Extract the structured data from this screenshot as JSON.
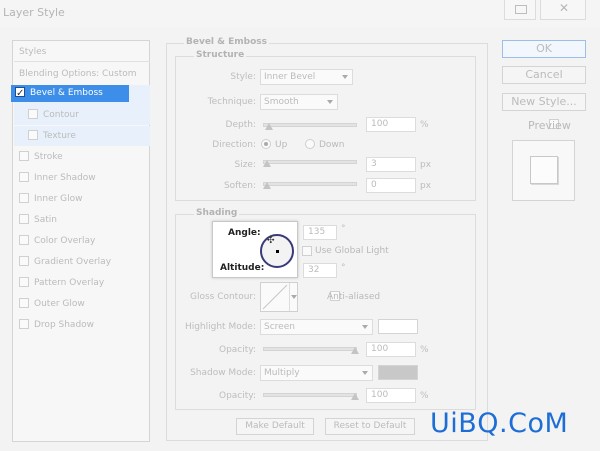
{
  "window": {
    "title": "Layer Style"
  },
  "styles_list": {
    "header": "Styles",
    "blending": "Blending Options: Custom",
    "bevel": "Bevel & Emboss",
    "contour": "Contour",
    "texture": "Texture",
    "items": [
      "Stroke",
      "Inner Shadow",
      "Inner Glow",
      "Satin",
      "Color Overlay",
      "Gradient Overlay",
      "Pattern Overlay",
      "Outer Glow",
      "Drop Shadow"
    ]
  },
  "bevel_emboss": {
    "group_title": "Bevel & Emboss",
    "structure_title": "Structure",
    "style_label": "Style:",
    "style_value": "Inner Bevel",
    "technique_label": "Technique:",
    "technique_value": "Smooth",
    "depth_label": "Depth:",
    "depth_value": "100",
    "depth_unit": "%",
    "direction_label": "Direction:",
    "direction_up": "Up",
    "direction_down": "Down",
    "size_label": "Size:",
    "size_value": "3",
    "size_unit": "px",
    "soften_label": "Soften:",
    "soften_value": "0",
    "soften_unit": "px"
  },
  "shading": {
    "group_title": "Shading",
    "angle_label": "Angle:",
    "angle_value": "135",
    "angle_unit": "°",
    "global_light_label": "Use Global Light",
    "altitude_label": "Altitude:",
    "altitude_value": "32",
    "altitude_unit": "°",
    "gloss_label": "Gloss Contour:",
    "anti_aliased_label": "Anti-aliased",
    "highlight_mode_label": "Highlight Mode:",
    "highlight_mode_value": "Screen",
    "highlight_color": "#ffffff",
    "hl_opacity_label": "Opacity:",
    "hl_opacity_value": "100",
    "hl_opacity_unit": "%",
    "shadow_mode_label": "Shadow Mode:",
    "shadow_mode_value": "Multiply",
    "shadow_color": "#c8c8c8",
    "sh_opacity_label": "Opacity:",
    "sh_opacity_value": "100",
    "sh_opacity_unit": "%"
  },
  "footer": {
    "make_default": "Make Default",
    "reset_default": "Reset to Default"
  },
  "right_buttons": {
    "ok": "OK",
    "cancel": "Cancel",
    "new_style": "New Style...",
    "preview": "Preview"
  },
  "watermark": "UiBQ.CoM",
  "colors": {
    "accent": "#3d8ee8",
    "watermark": "#1c6ed6"
  }
}
